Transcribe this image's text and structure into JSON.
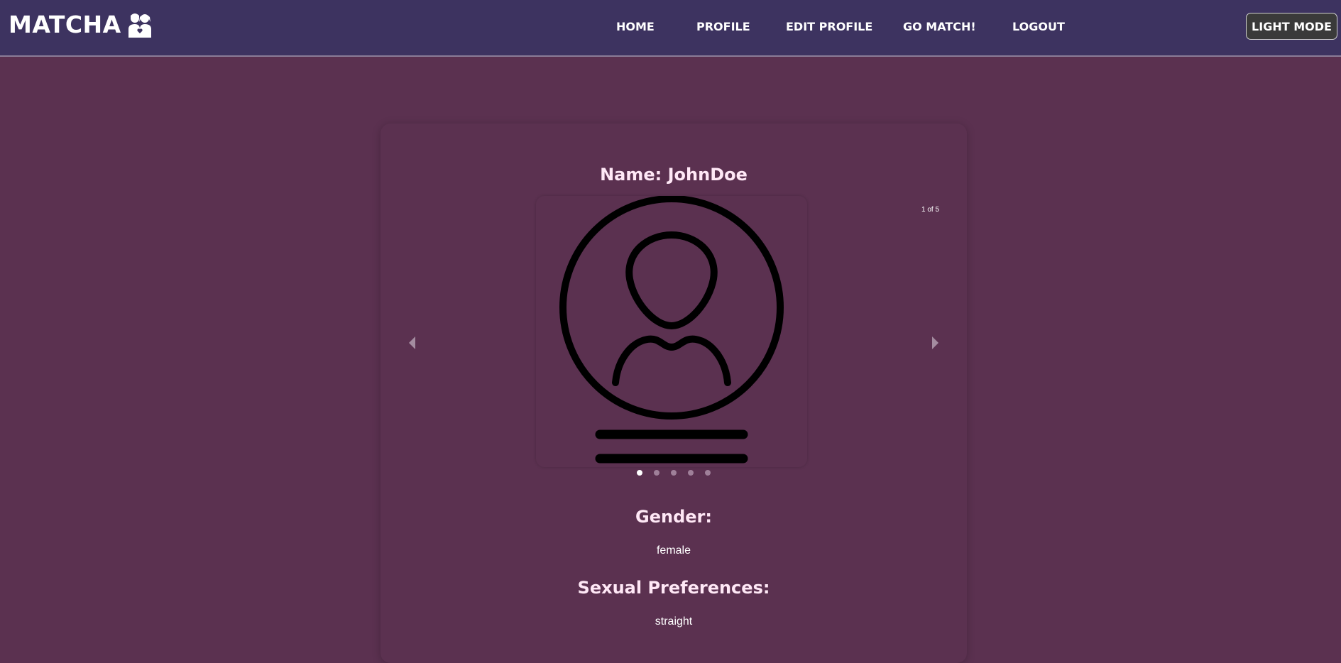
{
  "brand": {
    "name": "MATCHA",
    "logo_icon": "couple-icon"
  },
  "nav": {
    "items": [
      {
        "label": "HOME"
      },
      {
        "label": "PROFILE"
      },
      {
        "label": "EDIT PROFILE"
      },
      {
        "label": "GO MATCH!"
      },
      {
        "label": "LOGOUT"
      }
    ],
    "mode_toggle": "LIGHT MODE"
  },
  "profile": {
    "name_title": "Name: JohnDoe",
    "carousel": {
      "counter": "1 of 5",
      "total": 5,
      "current": 1,
      "image_icon": "user-placeholder-icon",
      "prev_icon": "caret-left-icon",
      "next_icon": "caret-right-icon"
    },
    "gender_label": "Gender:",
    "gender_value": "female",
    "preferences_label": "Sexual Preferences:",
    "preferences_value": "straight"
  },
  "colors": {
    "navbar_bg": "#3d3360",
    "page_bg": "#5b3150",
    "heading_text": "#ffe8f6",
    "toggle_bg": "#3a3a3a"
  }
}
